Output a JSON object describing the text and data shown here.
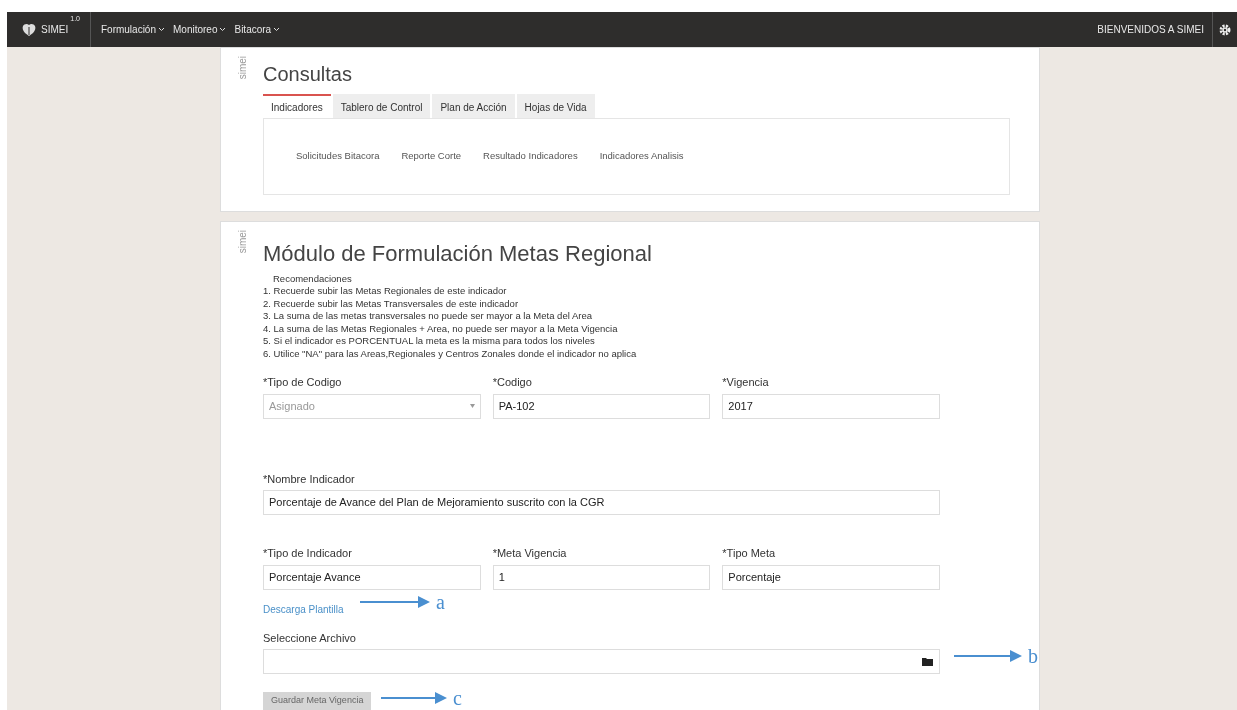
{
  "navbar": {
    "brand": "SIMEI",
    "version": "1.0",
    "menus": [
      {
        "label": "Formulación"
      },
      {
        "label": "Monitoreo"
      },
      {
        "label": "Bitacora"
      }
    ],
    "welcome": "BIENVENIDOS A SIMEI"
  },
  "consultas": {
    "side_label": "simei",
    "title": "Consultas",
    "tabs": [
      {
        "label": "Indicadores",
        "selected": true
      },
      {
        "label": "Tablero de Control",
        "selected": false
      },
      {
        "label": "Plan de Acción",
        "selected": false
      },
      {
        "label": "Hojas de Vida",
        "selected": false
      }
    ],
    "links": [
      "Solicitudes Bitacora",
      "Reporte Corte",
      "Resultado Indicadores",
      "Indicadores Analisis"
    ]
  },
  "modulo": {
    "side_label": "simei",
    "title": "Módulo de Formulación Metas Regional",
    "recommendations_title": "Recomendaciones",
    "recommendations": [
      "1. Recuerde subir las Metas Regionales de este indicador",
      "2. Recuerde subir las Metas Transversales de este indicador",
      "3. La suma de las metas transversales no puede ser mayor a la Meta del Area",
      "4. La suma de las Metas Regionales + Area, no puede ser mayor a la Meta Vigencia",
      "5. Si el indicador es PORCENTUAL la meta es la misma para todos los niveles",
      "6. Utilice \"NA\" para las Areas,Regionales y Centros Zonales donde el indicador no aplica"
    ],
    "rows": [
      [
        {
          "label": "*Tipo de Codigo",
          "value": "Asignado",
          "kind": "select",
          "disabled": true
        },
        {
          "label": "*Codigo",
          "value": "PA-102",
          "kind": "text"
        },
        {
          "label": "*Vigencia",
          "value": "2017",
          "kind": "text"
        }
      ],
      [
        {
          "label": "*Nombre Indicador",
          "value": "Porcentaje de Avance del Plan de Mejoramiento suscrito con la CGR",
          "kind": "text"
        }
      ],
      [
        {
          "label": "*Tipo de Indicador",
          "value": "Porcentaje Avance",
          "kind": "text"
        },
        {
          "label": "*Meta Vigencia",
          "value": "1",
          "kind": "text"
        },
        {
          "label": "*Tipo Meta",
          "value": "Porcentaje",
          "kind": "text"
        }
      ]
    ],
    "download_link": "Descarga Plantilla",
    "file_label": "Seleccione Archivo",
    "save_button": "Guardar Meta Vigencia"
  },
  "annotations": [
    "a",
    "b",
    "c"
  ]
}
